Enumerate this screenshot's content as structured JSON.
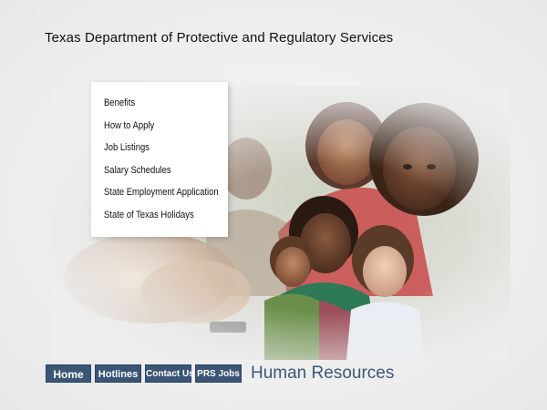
{
  "header": {
    "agency_title": "Texas Department of Protective and Regulatory Services"
  },
  "link_menu": {
    "items": [
      {
        "label": "Benefits"
      },
      {
        "label": "How to Apply"
      },
      {
        "label": "Job Listings"
      },
      {
        "label": "Salary Schedules"
      },
      {
        "label": "State Employment Application"
      },
      {
        "label": "State of Texas Holidays"
      }
    ]
  },
  "nav": {
    "home_label": "Home",
    "hotlines_label": "Hotlines",
    "contact_label": "Contact Us",
    "prs_jobs_label": "PRS Jobs"
  },
  "section": {
    "title": "Human Resources"
  },
  "colors": {
    "nav_button_bg": "#3b5575",
    "section_title": "#3e5877",
    "page_bg": "#eeeeee"
  }
}
